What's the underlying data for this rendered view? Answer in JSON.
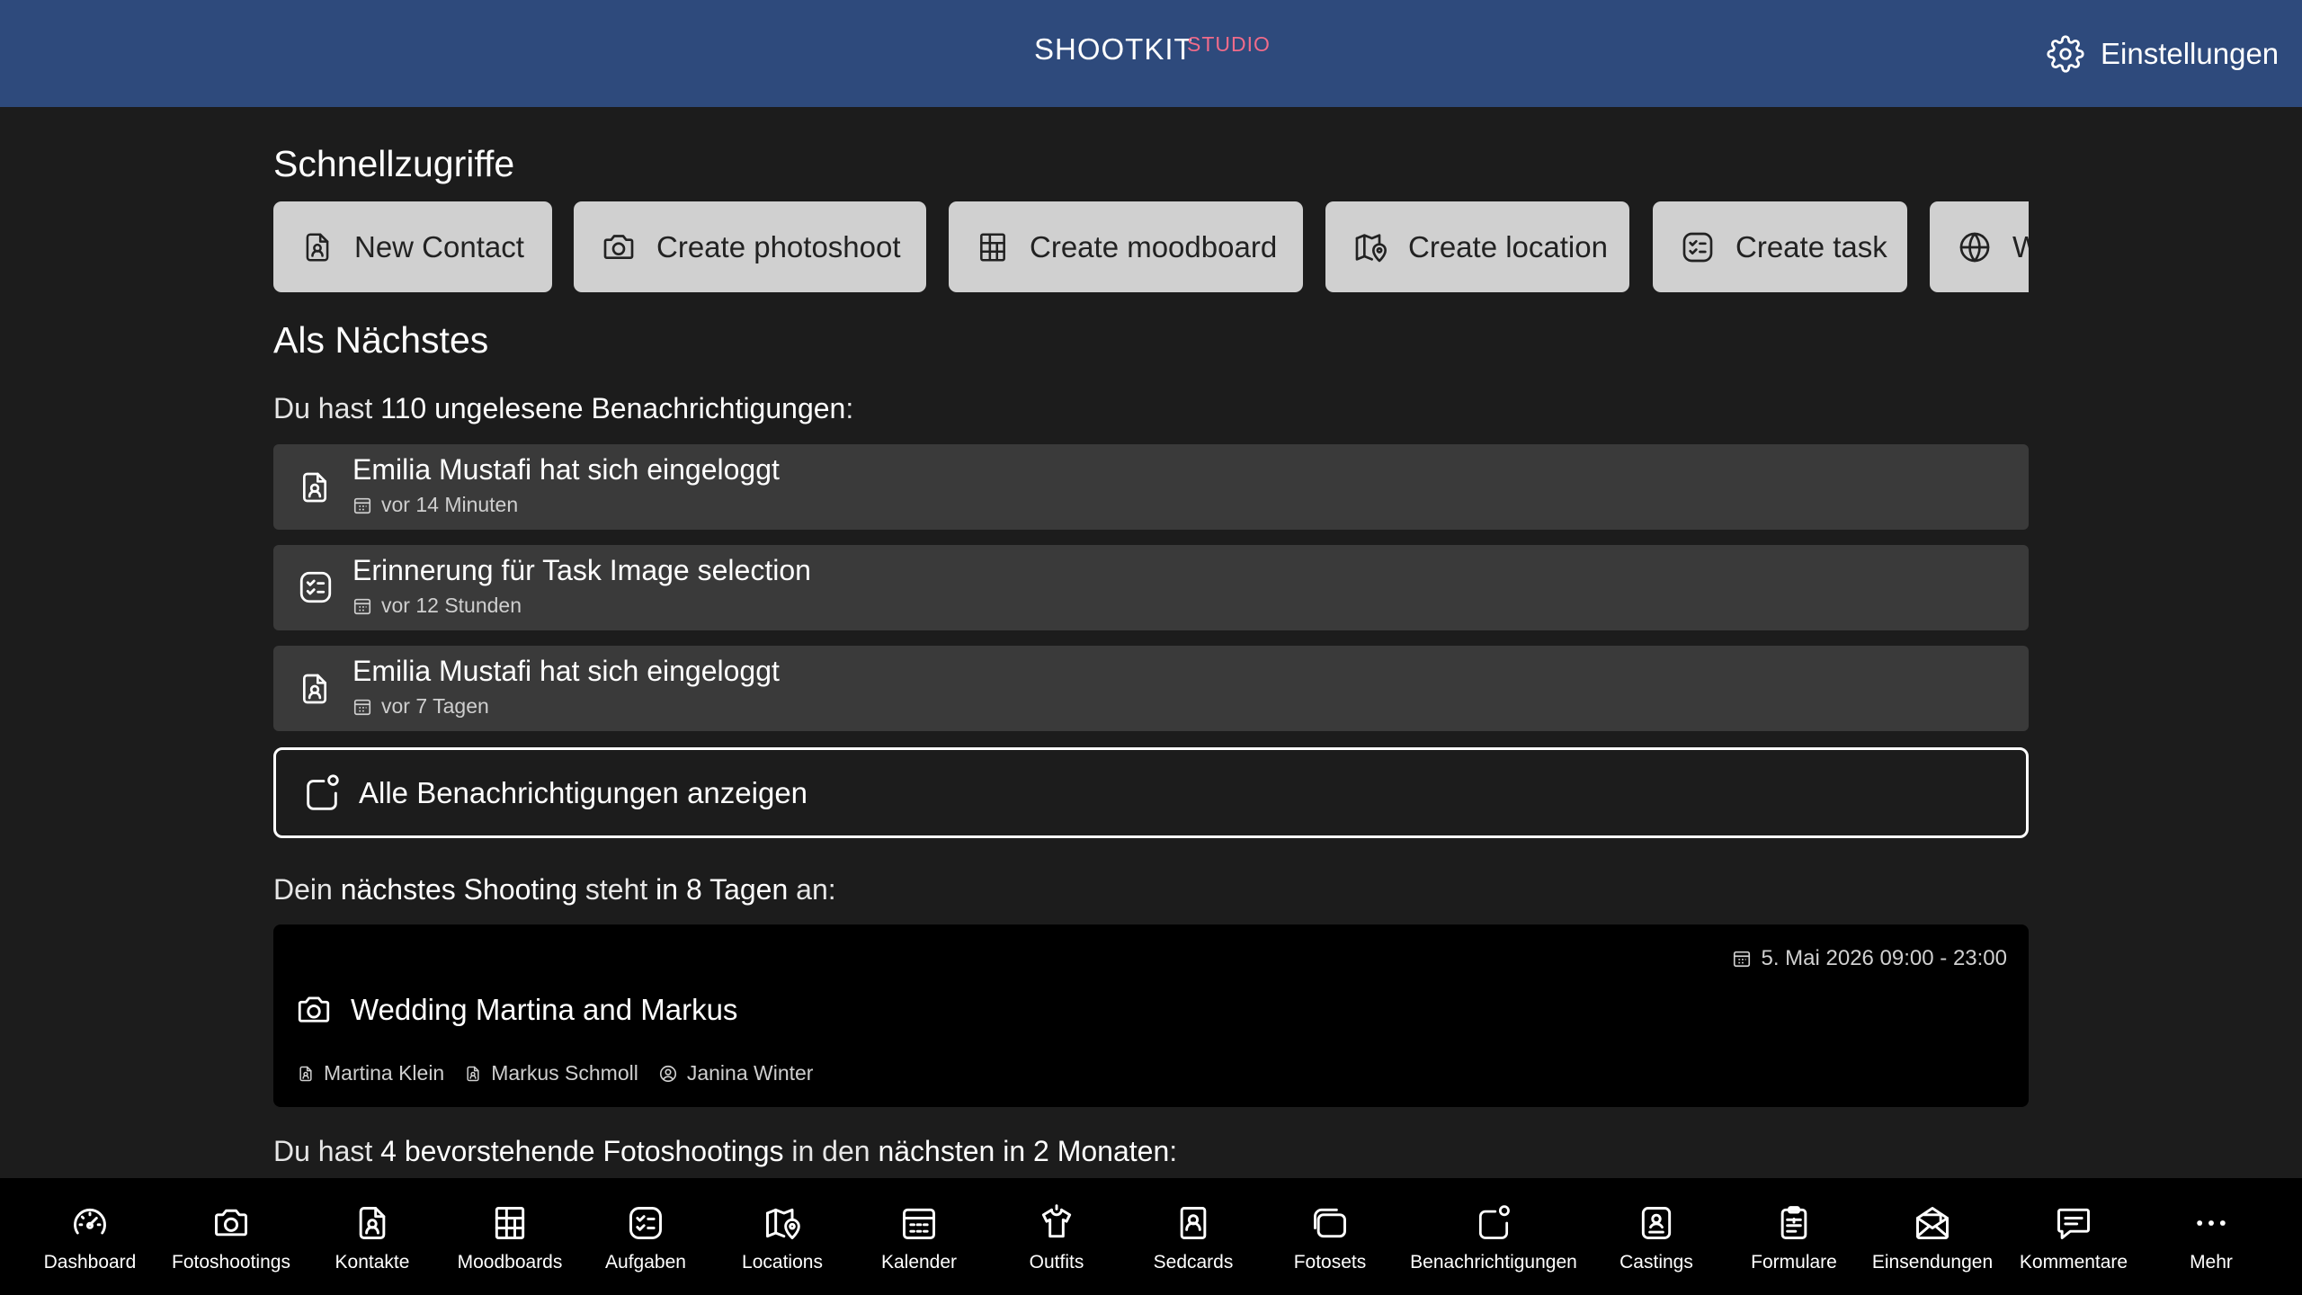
{
  "header": {
    "brand": "SHOOTKIT",
    "brand_sub": "STUDIO",
    "settings_label": "Einstellungen"
  },
  "quick_access": {
    "title": "Schnellzugriffe",
    "items": [
      {
        "label": "New Contact",
        "icon": "contact-icon"
      },
      {
        "label": "Create photoshoot",
        "icon": "camera-icon"
      },
      {
        "label": "Create moodboard",
        "icon": "moodboard-icon"
      },
      {
        "label": "Create location",
        "icon": "map-pin-icon"
      },
      {
        "label": "Create task",
        "icon": "task-icon"
      },
      {
        "label": "W",
        "icon": "globe-icon"
      }
    ]
  },
  "next": {
    "title": "Als Nächstes",
    "notif_prefix": "Du hast ",
    "notif_count_text": "110 ungelesene Benachrichtigungen",
    "notif_suffix": ":",
    "notifications": [
      {
        "title": "Emilia Mustafi hat sich eingeloggt",
        "time": "vor 14 Minuten",
        "icon": "contact-icon"
      },
      {
        "title": "Erinnerung für Task Image selection",
        "time": "vor 12 Stunden",
        "icon": "task-icon"
      },
      {
        "title": "Emilia Mustafi hat sich eingeloggt",
        "time": "vor 7 Tagen",
        "icon": "contact-icon"
      }
    ],
    "all_notifications_label": "Alle Benachrichtigungen anzeigen",
    "shoot_line": {
      "p1": "Dein ",
      "b1": "nächstes Shooting",
      "p2": " steht ",
      "b2": "in 8 Tagen",
      "p3": " an:"
    },
    "shoot": {
      "date": "5. Mai 2026 09:00 - 23:00",
      "title": "Wedding Martina and Markus",
      "people": [
        {
          "name": "Martina Klein",
          "icon": "contact-icon"
        },
        {
          "name": "Markus Schmoll",
          "icon": "contact-icon"
        },
        {
          "name": "Janina Winter",
          "icon": "user-circle-icon"
        }
      ]
    },
    "upcoming_line": {
      "p1": "Du hast ",
      "b1": "4 bevorstehende Fotoshootings",
      "p2": " in den ",
      "b2": "nächsten in 2 Monaten",
      "p3": ":"
    }
  },
  "bottom_nav": [
    {
      "label": "Dashboard",
      "icon": "dashboard-icon"
    },
    {
      "label": "Fotoshootings",
      "icon": "camera-icon"
    },
    {
      "label": "Kontakte",
      "icon": "contact-icon"
    },
    {
      "label": "Moodboards",
      "icon": "moodboard-icon"
    },
    {
      "label": "Aufgaben",
      "icon": "task-icon"
    },
    {
      "label": "Locations",
      "icon": "map-pin-icon"
    },
    {
      "label": "Kalender",
      "icon": "calendar-icon"
    },
    {
      "label": "Outfits",
      "icon": "shirt-icon"
    },
    {
      "label": "Sedcards",
      "icon": "sedcard-icon"
    },
    {
      "label": "Fotosets",
      "icon": "fotosets-icon"
    },
    {
      "label": "Benachrichtigungen",
      "icon": "bell-icon"
    },
    {
      "label": "Castings",
      "icon": "casting-icon"
    },
    {
      "label": "Formulare",
      "icon": "clipboard-icon"
    },
    {
      "label": "Einsendungen",
      "icon": "mail-icon"
    },
    {
      "label": "Kommentare",
      "icon": "comment-icon"
    },
    {
      "label": "Mehr",
      "icon": "more-icon"
    }
  ],
  "colors": {
    "header_bg": "#2e4a7c",
    "brand_accent": "#f06b8a",
    "page_bg": "#1c1c1c",
    "card_bg": "#3a3a3a",
    "quick_action_bg": "#d0d0d0",
    "nav_bg": "#000000"
  }
}
